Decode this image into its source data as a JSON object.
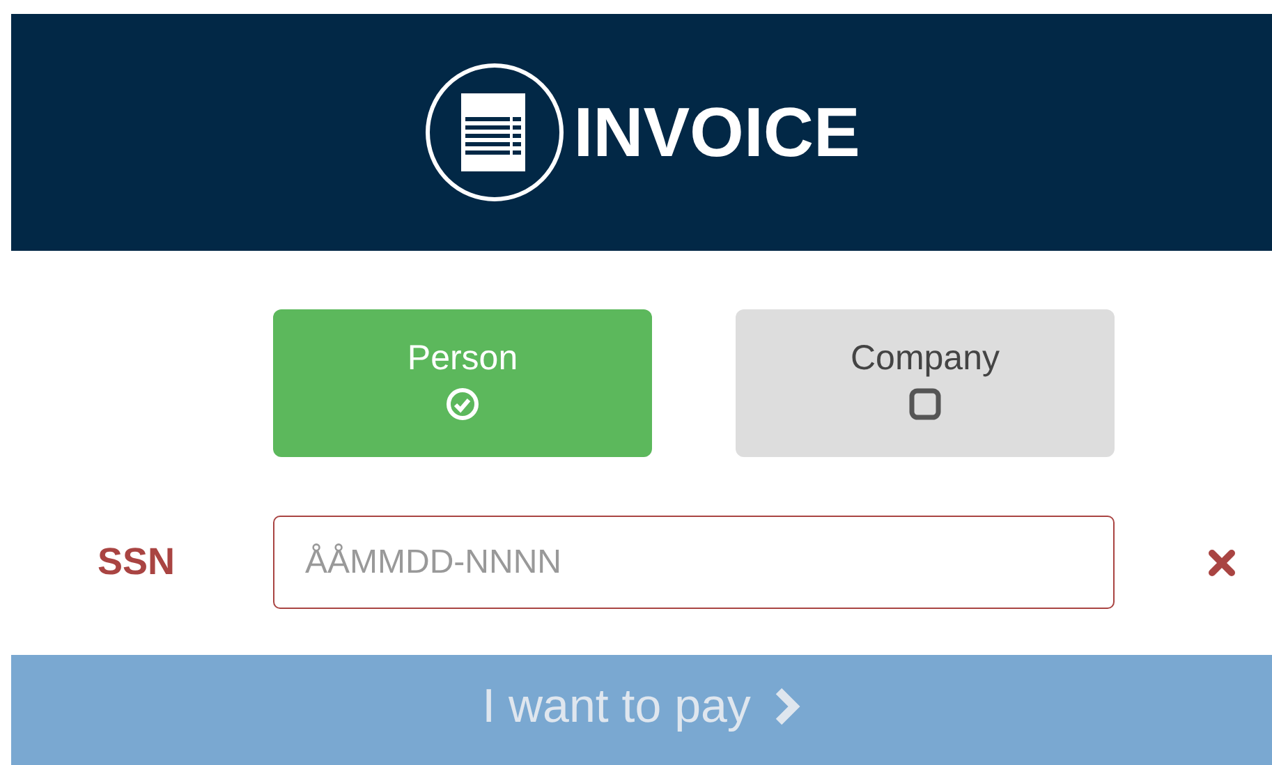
{
  "header": {
    "title": "INVOICE"
  },
  "customer_types": [
    {
      "label": "Person",
      "selected": true
    },
    {
      "label": "Company",
      "selected": false
    }
  ],
  "ssn": {
    "label": "SSN",
    "placeholder": "ÅÅMMDD-NNNN",
    "invalid": true
  },
  "pay_button": {
    "label": "I want to pay",
    "disabled": true
  }
}
